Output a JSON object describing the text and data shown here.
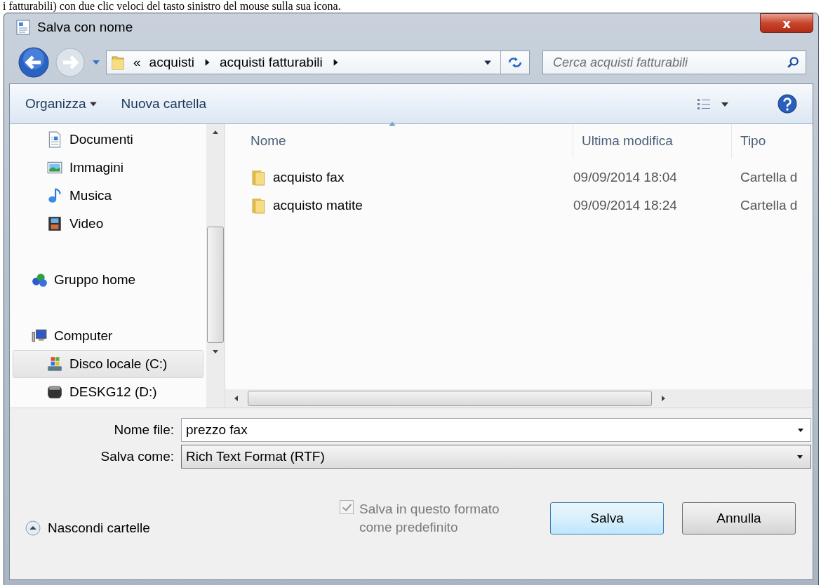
{
  "background_text": "i fatturabili) con due clic veloci del tasto sinistro del mouse sulla sua icona.",
  "window": {
    "title": "Salva con nome",
    "close": "x"
  },
  "address_bar": {
    "overflow": "«",
    "crumbs": [
      "acquisti",
      "acquisti fatturabili"
    ]
  },
  "search": {
    "placeholder": "Cerca acquisti fatturabili"
  },
  "toolbar": {
    "organize": "Organizza",
    "new_folder": "Nuova cartella"
  },
  "navigation": {
    "items_continued": [
      {
        "label": "Documenti",
        "kind": "documents",
        "selected": false
      },
      {
        "label": "Immagini",
        "kind": "pictures",
        "selected": false
      },
      {
        "label": "Musica",
        "kind": "music",
        "selected": false
      },
      {
        "label": "Video",
        "kind": "video",
        "selected": false
      }
    ],
    "items": [
      {
        "label": "Gruppo home",
        "kind": "homegroup",
        "selected": false
      },
      {
        "label": "Computer",
        "kind": "computer",
        "selected": false,
        "children": [
          {
            "label": "Disco locale (C:)",
            "kind": "system-drive",
            "selected": true
          },
          {
            "label": "DESKG12 (D:)",
            "kind": "drive",
            "selected": false
          }
        ]
      }
    ]
  },
  "file_list": {
    "columns": [
      "Nome",
      "Ultima modifica",
      "Tipo"
    ],
    "rows": [
      {
        "name": "acquisto fax",
        "modified": "09/09/2014 18:04",
        "type": "Cartella d"
      },
      {
        "name": "acquisto matite",
        "modified": "09/09/2014 18:24",
        "type": "Cartella d"
      }
    ]
  },
  "file_name": {
    "label": "Nome file:",
    "value": "prezzo fax"
  },
  "save_as_type": {
    "label": "Salva come:",
    "value": "Rich Text Format (RTF)"
  },
  "default_format": {
    "label": "Salva in questo formato come predefinito",
    "checked": true,
    "disabled": true
  },
  "hide_folders": "Nascondi cartelle",
  "buttons": [
    {
      "label": "Salva",
      "default": true
    },
    {
      "label": "Annulla",
      "default": false
    }
  ]
}
